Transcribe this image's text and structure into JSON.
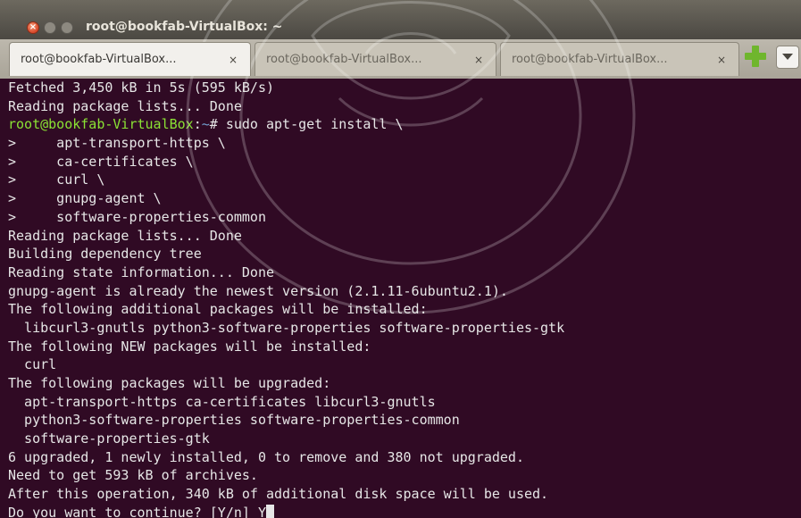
{
  "window": {
    "title": "root@bookfab-VirtualBox: ~"
  },
  "tabs": [
    {
      "label": "root@bookfab-VirtualBox...",
      "active": true
    },
    {
      "label": "root@bookfab-VirtualBox...",
      "active": false
    },
    {
      "label": "root@bookfab-VirtualBox...",
      "active": false
    }
  ],
  "icons": {
    "close_tab": "×",
    "new_tab": "plus-icon",
    "tabs_menu": "chevron-down-icon"
  },
  "colors": {
    "terminal_bg": "#300a24",
    "prompt_user": "#8ae234",
    "prompt_path": "#729fcf"
  },
  "terminal": {
    "lines": [
      "Fetched 3,450 kB in 5s (595 kB/s)",
      "Reading package lists... Done"
    ],
    "prompt": {
      "user_host": "root@bookfab-VirtualBox",
      "separator": ":",
      "path": "~",
      "symbol": "#",
      "command": " sudo apt-get install \\"
    },
    "output": [
      ">     apt-transport-https \\",
      ">     ca-certificates \\",
      ">     curl \\",
      ">     gnupg-agent \\",
      ">     software-properties-common",
      "Reading package lists... Done",
      "Building dependency tree",
      "Reading state information... Done",
      "gnupg-agent is already the newest version (2.1.11-6ubuntu2.1).",
      "The following additional packages will be installed:",
      "  libcurl3-gnutls python3-software-properties software-properties-gtk",
      "The following NEW packages will be installed:",
      "  curl",
      "The following packages will be upgraded:",
      "  apt-transport-https ca-certificates libcurl3-gnutls",
      "  python3-software-properties software-properties-common",
      "  software-properties-gtk",
      "6 upgraded, 1 newly installed, 0 to remove and 380 not upgraded.",
      "Need to get 593 kB of archives.",
      "After this operation, 340 kB of additional disk space will be used."
    ],
    "last_line": "Do you want to continue? [Y/n] Y"
  }
}
